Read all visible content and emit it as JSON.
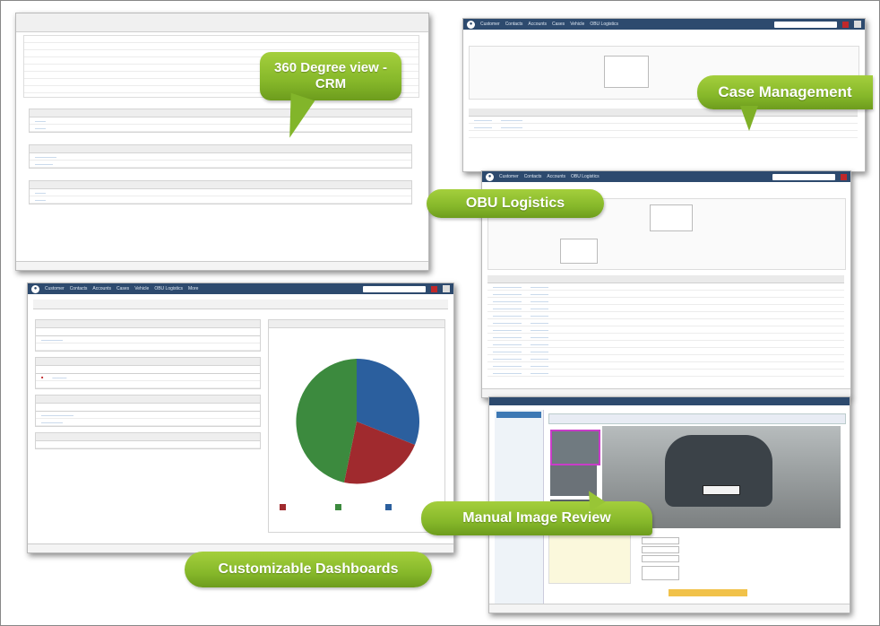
{
  "callouts": {
    "crm": "360 Degree view - CRM",
    "case_management": "Case Management",
    "obu_logistics": "OBU Logistics",
    "manual_image_review": "Manual Image Review",
    "dashboards": "Customizable Dashboards"
  },
  "nav_items": [
    "Customer",
    "Contacts",
    "Accounts",
    "Cases",
    "Vehicle",
    "OBU Logistics",
    "More"
  ],
  "colors": {
    "nav": "#2d4a6e",
    "callout": "#8fbf2e",
    "pie_blue": "#2b5f9e",
    "pie_green": "#3c8a3e",
    "pie_red": "#a02a2e"
  }
}
